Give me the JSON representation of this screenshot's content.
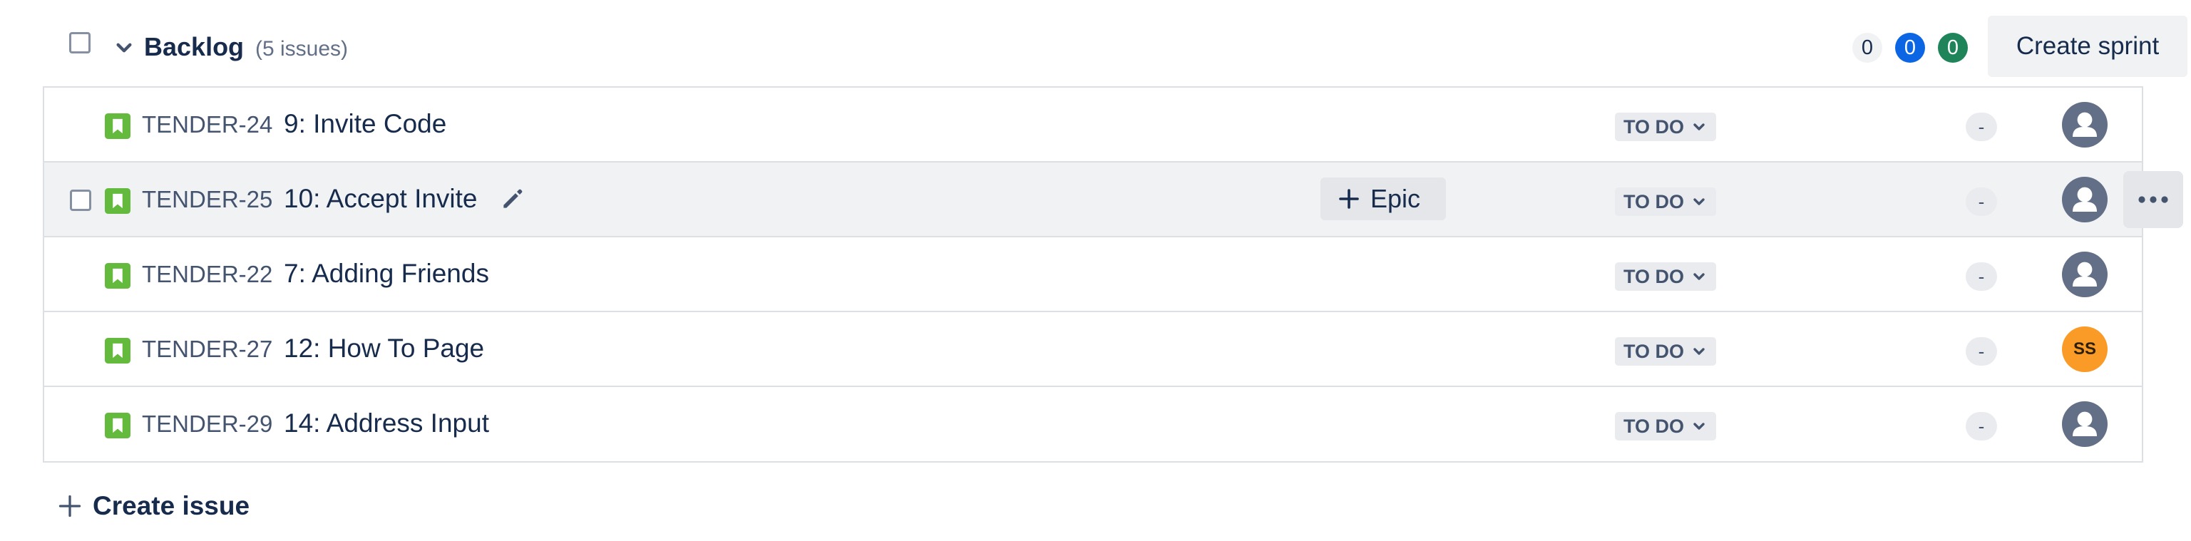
{
  "backlog": {
    "title": "Backlog",
    "issue_count": "(5 issues)",
    "counts": {
      "todo": "0",
      "in_progress": "0",
      "done": "0"
    },
    "create_sprint_label": "Create sprint"
  },
  "issues": [
    {
      "key": "TENDER-24",
      "summary": "9: Invite Code",
      "status": "TO DO",
      "points": "-",
      "assignee": "unassigned"
    },
    {
      "key": "TENDER-25",
      "summary": "10: Accept Invite",
      "status": "TO DO",
      "points": "-",
      "assignee": "unassigned",
      "epic_label": "Epic"
    },
    {
      "key": "TENDER-22",
      "summary": "7: Adding Friends",
      "status": "TO DO",
      "points": "-",
      "assignee": "unassigned"
    },
    {
      "key": "TENDER-27",
      "summary": "12: How To Page",
      "status": "TO DO",
      "points": "-",
      "assignee": "SS"
    },
    {
      "key": "TENDER-29",
      "summary": "14: Address Input",
      "status": "TO DO",
      "points": "-",
      "assignee": "unassigned"
    }
  ],
  "create_issue_label": "Create issue",
  "icons": {
    "story": "story-icon",
    "chevron": "chevron-down-icon",
    "edit": "pencil-icon",
    "add": "plus-icon",
    "more": "more-actions-icon",
    "avatar": "user-avatar-icon"
  },
  "colors": {
    "story_green": "#63ba3c",
    "in_progress_blue": "#0c66e4",
    "done_green": "#1f845a",
    "avatar_orange": "#f99b26"
  }
}
